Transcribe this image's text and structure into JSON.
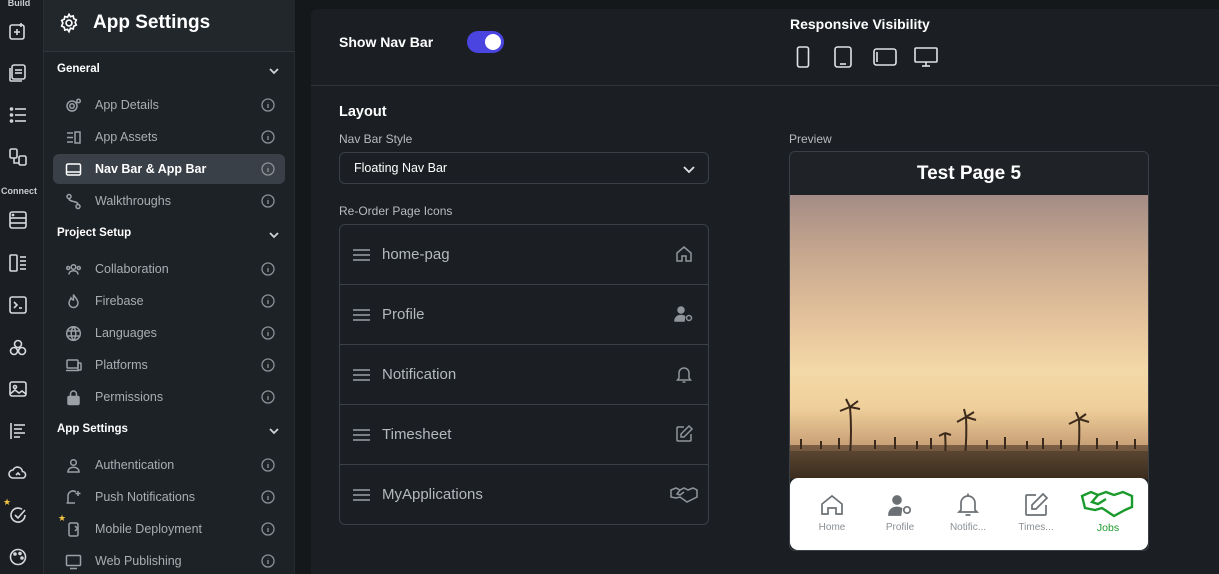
{
  "rail": {
    "build_label": "Build",
    "connect_label": "Connect"
  },
  "sidebar": {
    "title": "App Settings",
    "sections": [
      {
        "label": "General",
        "items": [
          {
            "label": "App Details",
            "icon": "gear-cluster-icon"
          },
          {
            "label": "App Assets",
            "icon": "assets-icon"
          },
          {
            "label": "Nav Bar & App Bar",
            "icon": "navbar-icon",
            "active": true
          },
          {
            "label": "Walkthroughs",
            "icon": "route-icon"
          }
        ]
      },
      {
        "label": "Project Setup",
        "items": [
          {
            "label": "Collaboration",
            "icon": "people-icon"
          },
          {
            "label": "Firebase",
            "icon": "flame-icon"
          },
          {
            "label": "Languages",
            "icon": "globe-icon"
          },
          {
            "label": "Platforms",
            "icon": "laptop-icon"
          },
          {
            "label": "Permissions",
            "icon": "lock-icon"
          }
        ]
      },
      {
        "label": "App Settings",
        "items": [
          {
            "label": "Authentication",
            "icon": "person-icon"
          },
          {
            "label": "Push Notifications",
            "icon": "notification-sparkle-icon"
          },
          {
            "label": "Mobile Deployment",
            "icon": "mobile-deploy-icon"
          },
          {
            "label": "Web Publishing",
            "icon": "monitor-icon"
          }
        ]
      }
    ]
  },
  "topbar": {
    "show_nav_bar_label": "Show Nav Bar",
    "show_nav_bar_on": true,
    "responsive_visibility_label": "Responsive Visibility"
  },
  "layout": {
    "title": "Layout",
    "nav_bar_style_label": "Nav Bar Style",
    "nav_bar_style_value": "Floating Nav Bar",
    "reorder_label": "Re-Order Page Icons",
    "pages": [
      {
        "name": "home-pag",
        "icon": "home-icon"
      },
      {
        "name": "Profile",
        "icon": "person-gear-icon"
      },
      {
        "name": "Notification",
        "icon": "bell-icon"
      },
      {
        "name": "Timesheet",
        "icon": "edit-icon"
      },
      {
        "name": "MyApplications",
        "icon": "handshake-icon"
      }
    ]
  },
  "preview": {
    "label": "Preview",
    "page_title": "Test Page 5",
    "nav_items": [
      {
        "label": "Home",
        "icon": "home-icon"
      },
      {
        "label": "Profile",
        "icon": "person-gear-icon"
      },
      {
        "label": "Notific...",
        "icon": "bell-icon"
      },
      {
        "label": "Times...",
        "icon": "edit-icon"
      },
      {
        "label": "Jobs",
        "icon": "handshake-icon",
        "selected": true
      }
    ],
    "selected_color": "#1a9a2c",
    "accent_toggle_color": "#4a44e0"
  }
}
